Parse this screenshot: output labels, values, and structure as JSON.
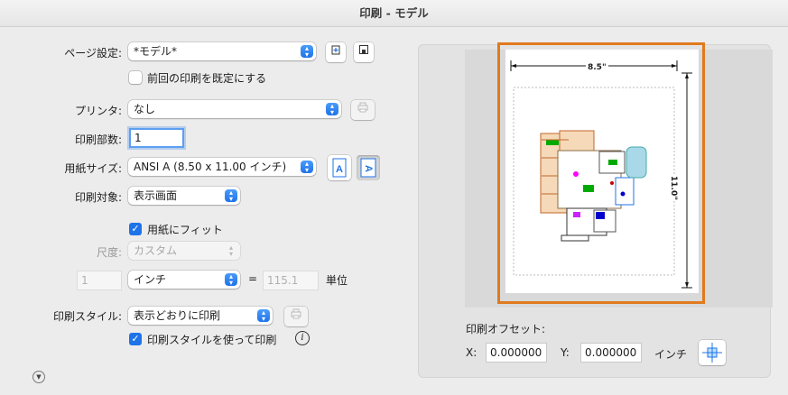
{
  "window": {
    "title": "印刷 - モデル"
  },
  "page_setup": {
    "label": "ページ設定:",
    "value": "*モデル*",
    "checkbox_label": "前回の印刷を既定にする"
  },
  "printer": {
    "label": "プリンタ:",
    "value": "なし"
  },
  "copies": {
    "label": "印刷部数:",
    "value": "1"
  },
  "paper_size": {
    "label": "用紙サイズ:",
    "value": "ANSI A (8.50 x 11.00 インチ)"
  },
  "plot_area": {
    "label": "印刷対象:",
    "value": "表示画面"
  },
  "scale": {
    "fit_label": "用紙にフィット",
    "fit_checked": true,
    "label": "尺度:",
    "value": "カスタム",
    "left_value": "1",
    "unit": "インチ",
    "equals": "=",
    "right_value": "115.1",
    "right_unit": "単位"
  },
  "plot_style": {
    "label": "印刷スタイル:",
    "value": "表示どおりに印刷",
    "use_label": "印刷スタイルを使って印刷",
    "use_checked": true
  },
  "preview": {
    "width_dim": "8.5\"",
    "height_dim": "11.0\"",
    "accent_color": "#e07a1e"
  },
  "offset": {
    "label": "印刷オフセット:",
    "x_label": "X:",
    "x_value": "0.000000",
    "y_label": "Y:",
    "y_value": "0.000000",
    "unit": "インチ"
  },
  "icons": {
    "orient_portrait": "A",
    "orient_landscape": "A"
  }
}
